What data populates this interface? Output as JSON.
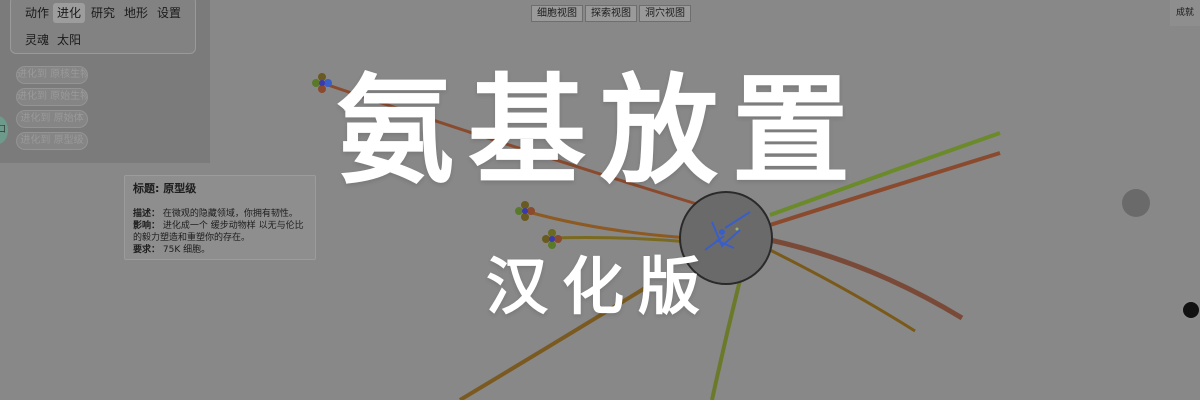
{
  "menu": {
    "tabs_row1": [
      "动作",
      "进化",
      "研究",
      "地形",
      "设置"
    ],
    "tabs_row2": [
      "灵魂",
      "太阳"
    ],
    "active_tab": "进化",
    "evolve_buttons": [
      "进化到 原核生物",
      "进化到 原始生物",
      "进化到 原始体",
      "进化到 原型级"
    ],
    "side_bubble": "口"
  },
  "tooltip": {
    "title": "标题: 原型级",
    "desc_key": "描述：",
    "desc": "在微观的隐藏领域，你拥有韧性。",
    "effect_key": "影响：",
    "effect": "进化成一个 缓步动物样 以无与伦比的毅力塑造和重塑你的存在。",
    "req_key": "要求：",
    "req": "75K 细胞。"
  },
  "view_buttons": [
    "细胞视图",
    "探索视图",
    "洞穴视图"
  ],
  "achievements_label": "成就",
  "title": {
    "main": "氨基放置",
    "sub": "汉化版"
  },
  "colors": {
    "background": "#888888",
    "title": "#ffffff",
    "root_brown": "#8a4a2e",
    "root_olive": "#6b7a2a",
    "cell_body": "#6a6a6a",
    "organism": "#3a5ec8"
  },
  "icons": [
    "flower-icon",
    "grey-dot-icon",
    "github-icon"
  ]
}
